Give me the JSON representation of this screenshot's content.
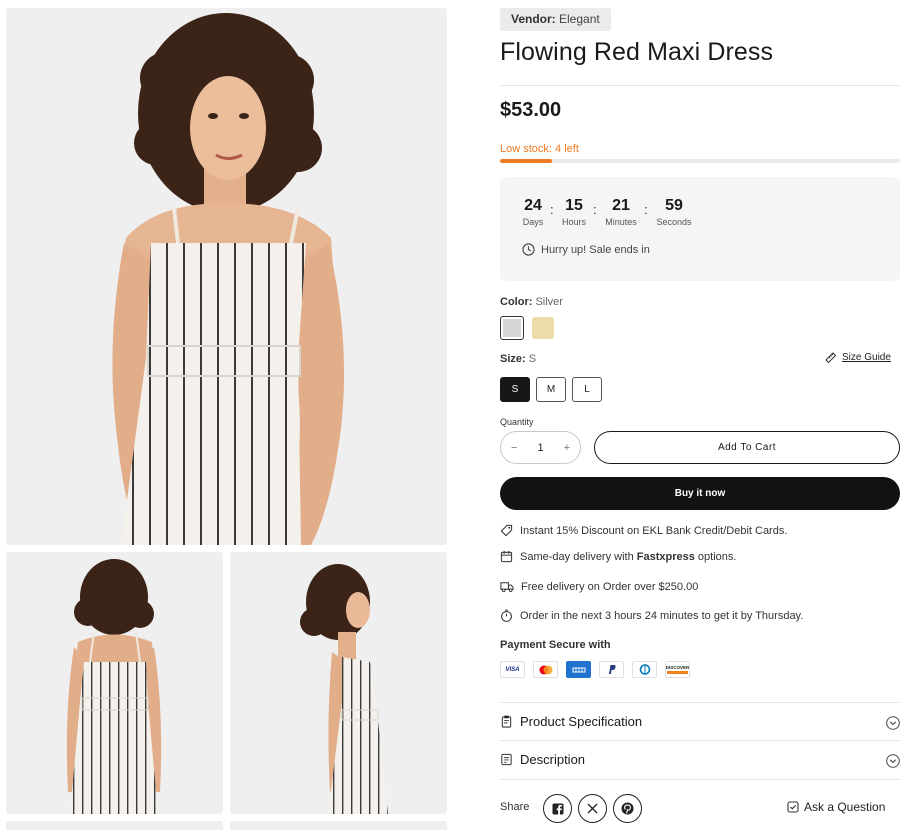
{
  "vendor": {
    "label": "Vendor:",
    "value": "Elegant"
  },
  "product": {
    "title": "Flowing Red Maxi Dress",
    "price": "$53.00"
  },
  "stock": {
    "label": "Low stock: 4 left",
    "fill_percent": 13
  },
  "countdown": {
    "units": [
      {
        "value": "24",
        "label": "Days"
      },
      {
        "value": "15",
        "label": "Hours"
      },
      {
        "value": "21",
        "label": "Minutes"
      },
      {
        "value": "59",
        "label": "Seconds"
      }
    ],
    "separator": ":",
    "message": "Hurry up! Sale ends in"
  },
  "color": {
    "label": "Color:",
    "selected": "Silver",
    "swatches": [
      {
        "name": "Silver",
        "hex": "#d6d6d6"
      },
      {
        "name": "Beige",
        "hex": "#ecdcaa"
      }
    ]
  },
  "size": {
    "label": "Size:",
    "selected": "S",
    "guide_label": "Size Guide",
    "options": [
      "S",
      "M",
      "L"
    ]
  },
  "quantity": {
    "label": "Quantity",
    "value": "1",
    "minus": "−",
    "plus": "+"
  },
  "buttons": {
    "add_to_cart": "Add To Cart",
    "buy_now": "Buy it now"
  },
  "perks": {
    "discount": "Instant 15% Discount on EKL Bank Credit/Debit Cards.",
    "same_day_pre": "Same-day delivery with ",
    "same_day_brand": "Fastxpress",
    "same_day_post": " options.",
    "free_delivery": "Free delivery on Order over $250.00",
    "order_next": "Order in the next 3 hours 24 minutes to get it by Thursday."
  },
  "payment": {
    "title": "Payment Secure with",
    "cards": [
      "VISA",
      "mastercard",
      "amex",
      "paypal",
      "diners",
      "DISCOVER"
    ]
  },
  "accordion": {
    "spec": "Product Specification",
    "description": "Description"
  },
  "share": {
    "label": "Share",
    "networks": [
      "facebook",
      "x",
      "pinterest"
    ]
  },
  "ask": "Ask a Question",
  "colors": {
    "accent": "#ee7a24",
    "dark": "#121212",
    "panel": "#f5f5f5",
    "photo_bg": "#efefef"
  }
}
